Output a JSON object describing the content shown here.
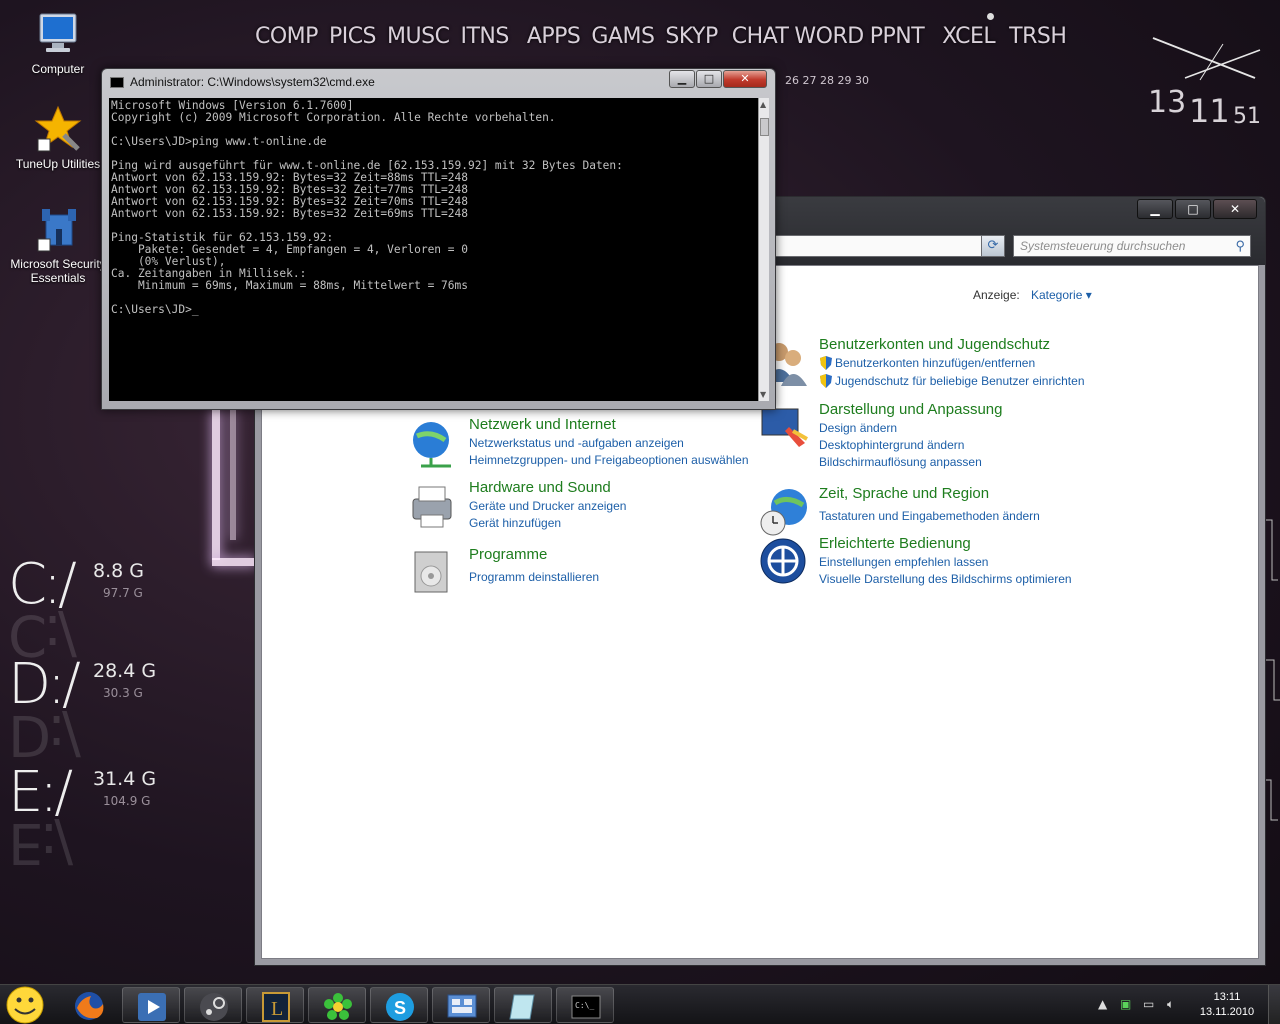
{
  "desktop": {
    "icons": [
      {
        "label": "Computer"
      },
      {
        "label": "TuneUp Utilities"
      },
      {
        "label": "Microsoft Security Essentials"
      }
    ]
  },
  "topnav": {
    "items": [
      "COMP",
      "PICS",
      "MUSC",
      "ITNS",
      "APPS",
      "GAMS",
      "SKYP",
      "CHAT",
      "WORD",
      "PPNT",
      "XCEL",
      "TRSH"
    ],
    "dates": "26 27 28 29 30"
  },
  "clock": {
    "hours": "13",
    "minutes": "11",
    "seconds": "51"
  },
  "drives": [
    {
      "letter": "C:/",
      "free": "8.8 G",
      "total": "97.7 G"
    },
    {
      "letter": "D:/",
      "free": "28.4 G",
      "total": "30.3 G"
    },
    {
      "letter": "E:/",
      "free": "31.4 G",
      "total": "104.9 G"
    }
  ],
  "cmd": {
    "title": "Administrator: C:\\Windows\\system32\\cmd.exe",
    "console": "Microsoft Windows [Version 6.1.7600]\nCopyright (c) 2009 Microsoft Corporation. Alle Rechte vorbehalten.\n\nC:\\Users\\JD>ping www.t-online.de\n\nPing wird ausgeführt für www.t-online.de [62.153.159.92] mit 32 Bytes Daten:\nAntwort von 62.153.159.92: Bytes=32 Zeit=88ms TTL=248\nAntwort von 62.153.159.92: Bytes=32 Zeit=77ms TTL=248\nAntwort von 62.153.159.92: Bytes=32 Zeit=70ms TTL=248\nAntwort von 62.153.159.92: Bytes=32 Zeit=69ms TTL=248\n\nPing-Statistik für 62.153.159.92:\n    Pakete: Gesendet = 4, Empfangen = 4, Verloren = 0\n    (0% Verlust),\nCa. Zeitangaben in Millisek.:\n    Minimum = 69ms, Maximum = 88ms, Mittelwert = 76ms\n\nC:\\Users\\JD>_"
  },
  "control_panel": {
    "search_placeholder": "Systemsteuerung durchsuchen",
    "view_label": "Anzeige:",
    "view_value": "Kategorie ▾",
    "categories": [
      {
        "title": "Benutzerkonten und Jugendschutz",
        "links": [
          "Benutzerkonten hinzufügen/entfernen",
          "Jugendschutz für beliebige Benutzer einrichten"
        ]
      },
      {
        "title": "Darstellung und Anpassung",
        "links": [
          "Design ändern",
          "Desktophintergrund ändern",
          "Bildschirmauflösung anpassen"
        ]
      },
      {
        "title": "Netzwerk und Internet",
        "links": [
          "Netzwerkstatus und -aufgaben anzeigen",
          "Heimnetzgruppen- und Freigabeoptionen auswählen"
        ]
      },
      {
        "title": "Hardware und Sound",
        "links": [
          "Geräte und Drucker anzeigen",
          "Gerät hinzufügen"
        ]
      },
      {
        "title": "Zeit, Sprache und Region",
        "links": [
          "Tastaturen und Eingabemethoden ändern"
        ]
      },
      {
        "title": "Programme",
        "links": [
          "Programm deinstallieren"
        ]
      },
      {
        "title": "Erleichterte Bedienung",
        "links": [
          "Einstellungen empfehlen lassen",
          "Visuelle Darstellung des Bildschirms optimieren"
        ]
      }
    ]
  },
  "taskbar": {
    "apps": [
      "smiley-start",
      "firefox",
      "media-player",
      "steam",
      "league-of-legends",
      "icq",
      "skype",
      "control-panel",
      "notepad",
      "cmd"
    ],
    "time": "13:11",
    "date": "13.11.2010"
  }
}
